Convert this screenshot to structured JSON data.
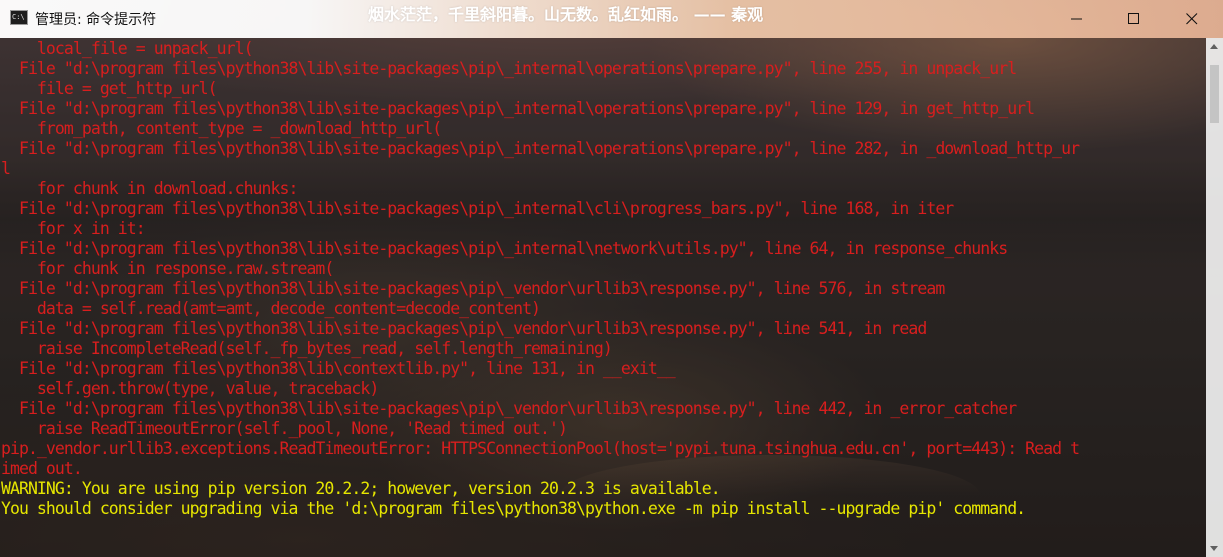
{
  "window": {
    "title": "管理员: 命令提示符",
    "icon_label": "C:\\",
    "banner": "烟水茫茫，千里斜阳暮。山无数。乱红如雨。 —— 秦观",
    "controls": {
      "minimize_icon": "minimize-icon",
      "maximize_icon": "maximize-icon",
      "close_icon": "close-icon"
    }
  },
  "colors": {
    "error_text": "#d81e1e",
    "warning_text": "#e6e600"
  },
  "console": {
    "lines": [
      {
        "text": "    local_file = unpack_url(",
        "type": "error"
      },
      {
        "text": "  File \"d:\\program files\\python38\\lib\\site-packages\\pip\\_internal\\operations\\prepare.py\", line 255, in unpack_url",
        "type": "error"
      },
      {
        "text": "    file = get_http_url(",
        "type": "error"
      },
      {
        "text": "  File \"d:\\program files\\python38\\lib\\site-packages\\pip\\_internal\\operations\\prepare.py\", line 129, in get_http_url",
        "type": "error"
      },
      {
        "text": "    from_path, content_type = _download_http_url(",
        "type": "error"
      },
      {
        "text": "  File \"d:\\program files\\python38\\lib\\site-packages\\pip\\_internal\\operations\\prepare.py\", line 282, in _download_http_ur",
        "type": "error"
      },
      {
        "text": "l",
        "type": "error"
      },
      {
        "text": "    for chunk in download.chunks:",
        "type": "error"
      },
      {
        "text": "  File \"d:\\program files\\python38\\lib\\site-packages\\pip\\_internal\\cli\\progress_bars.py\", line 168, in iter",
        "type": "error"
      },
      {
        "text": "    for x in it:",
        "type": "error"
      },
      {
        "text": "  File \"d:\\program files\\python38\\lib\\site-packages\\pip\\_internal\\network\\utils.py\", line 64, in response_chunks",
        "type": "error"
      },
      {
        "text": "    for chunk in response.raw.stream(",
        "type": "error"
      },
      {
        "text": "  File \"d:\\program files\\python38\\lib\\site-packages\\pip\\_vendor\\urllib3\\response.py\", line 576, in stream",
        "type": "error"
      },
      {
        "text": "    data = self.read(amt=amt, decode_content=decode_content)",
        "type": "error"
      },
      {
        "text": "  File \"d:\\program files\\python38\\lib\\site-packages\\pip\\_vendor\\urllib3\\response.py\", line 541, in read",
        "type": "error"
      },
      {
        "text": "    raise IncompleteRead(self._fp_bytes_read, self.length_remaining)",
        "type": "error"
      },
      {
        "text": "  File \"d:\\program files\\python38\\lib\\contextlib.py\", line 131, in __exit__",
        "type": "error"
      },
      {
        "text": "    self.gen.throw(type, value, traceback)",
        "type": "error"
      },
      {
        "text": "  File \"d:\\program files\\python38\\lib\\site-packages\\pip\\_vendor\\urllib3\\response.py\", line 442, in _error_catcher",
        "type": "error"
      },
      {
        "text": "    raise ReadTimeoutError(self._pool, None, 'Read timed out.')",
        "type": "error"
      },
      {
        "text": "pip._vendor.urllib3.exceptions.ReadTimeoutError: HTTPSConnectionPool(host='pypi.tuna.tsinghua.edu.cn', port=443): Read t",
        "type": "error"
      },
      {
        "text": "imed out.",
        "type": "error"
      },
      {
        "text": "WARNING: You are using pip version 20.2.2; however, version 20.2.3 is available.",
        "type": "warning"
      },
      {
        "text": "You should consider upgrading via the 'd:\\program files\\python38\\python.exe -m pip install --upgrade pip' command.",
        "type": "warning"
      }
    ]
  }
}
